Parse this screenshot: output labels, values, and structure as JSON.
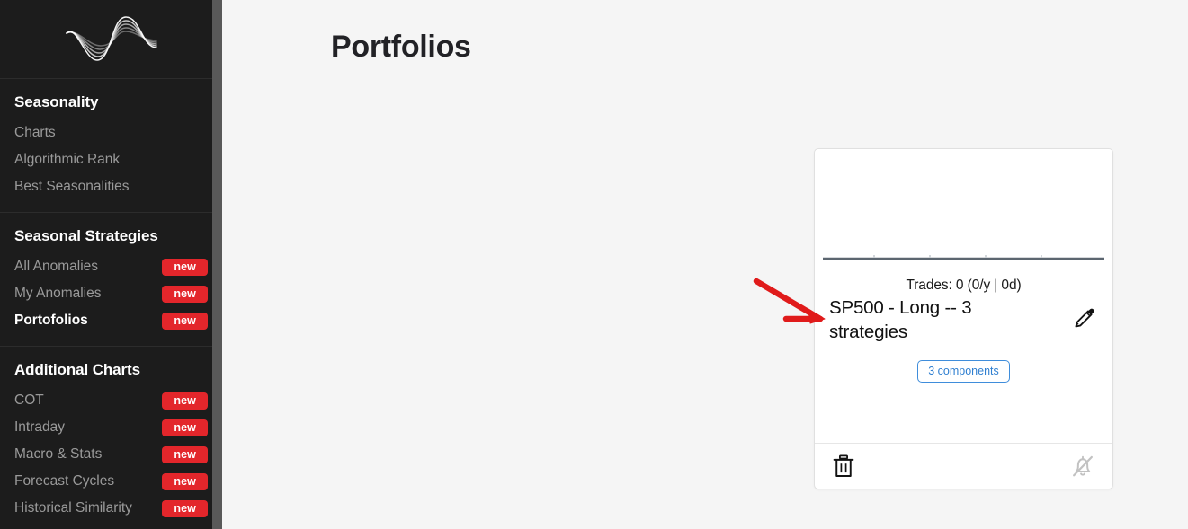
{
  "sidebar": {
    "logo_name": "wave-logo",
    "sections": [
      {
        "heading": "Seasonality",
        "items": [
          {
            "label": "Charts",
            "badge": "",
            "active": false
          },
          {
            "label": "Algorithmic Rank",
            "badge": "",
            "active": false
          },
          {
            "label": "Best Seasonalities",
            "badge": "",
            "active": false
          }
        ]
      },
      {
        "heading": "Seasonal Strategies",
        "items": [
          {
            "label": "All Anomalies",
            "badge": "new",
            "active": false
          },
          {
            "label": "My Anomalies",
            "badge": "new",
            "active": false
          },
          {
            "label": "Portofolios",
            "badge": "new",
            "active": true
          }
        ]
      },
      {
        "heading": "Additional Charts",
        "items": [
          {
            "label": "COT",
            "badge": "new",
            "active": false
          },
          {
            "label": "Intraday",
            "badge": "new",
            "active": false
          },
          {
            "label": "Macro & Stats",
            "badge": "new",
            "active": false
          },
          {
            "label": "Forecast Cycles",
            "badge": "new",
            "active": false
          },
          {
            "label": "Historical Similarity",
            "badge": "new",
            "active": false
          }
        ]
      }
    ],
    "badge_color": "#e3262b",
    "background_color": "#1c1c1c"
  },
  "main": {
    "page_title": "Portfolios",
    "background_color": "#f5f5f5"
  },
  "card": {
    "trades_text": "Trades: 0 (0/y | 0d)",
    "title": "SP500 - Long -- 3 strategies",
    "components_badge": "3 components",
    "components_badge_color": "#3f8ddb",
    "edit_icon": "pencil-icon",
    "delete_icon": "trash-icon",
    "alert_icon": "bell-slash-icon",
    "chart_empty": true
  },
  "annotation": {
    "arrow_icon": "red-arrow-annotation",
    "color": "#e01b1b"
  }
}
